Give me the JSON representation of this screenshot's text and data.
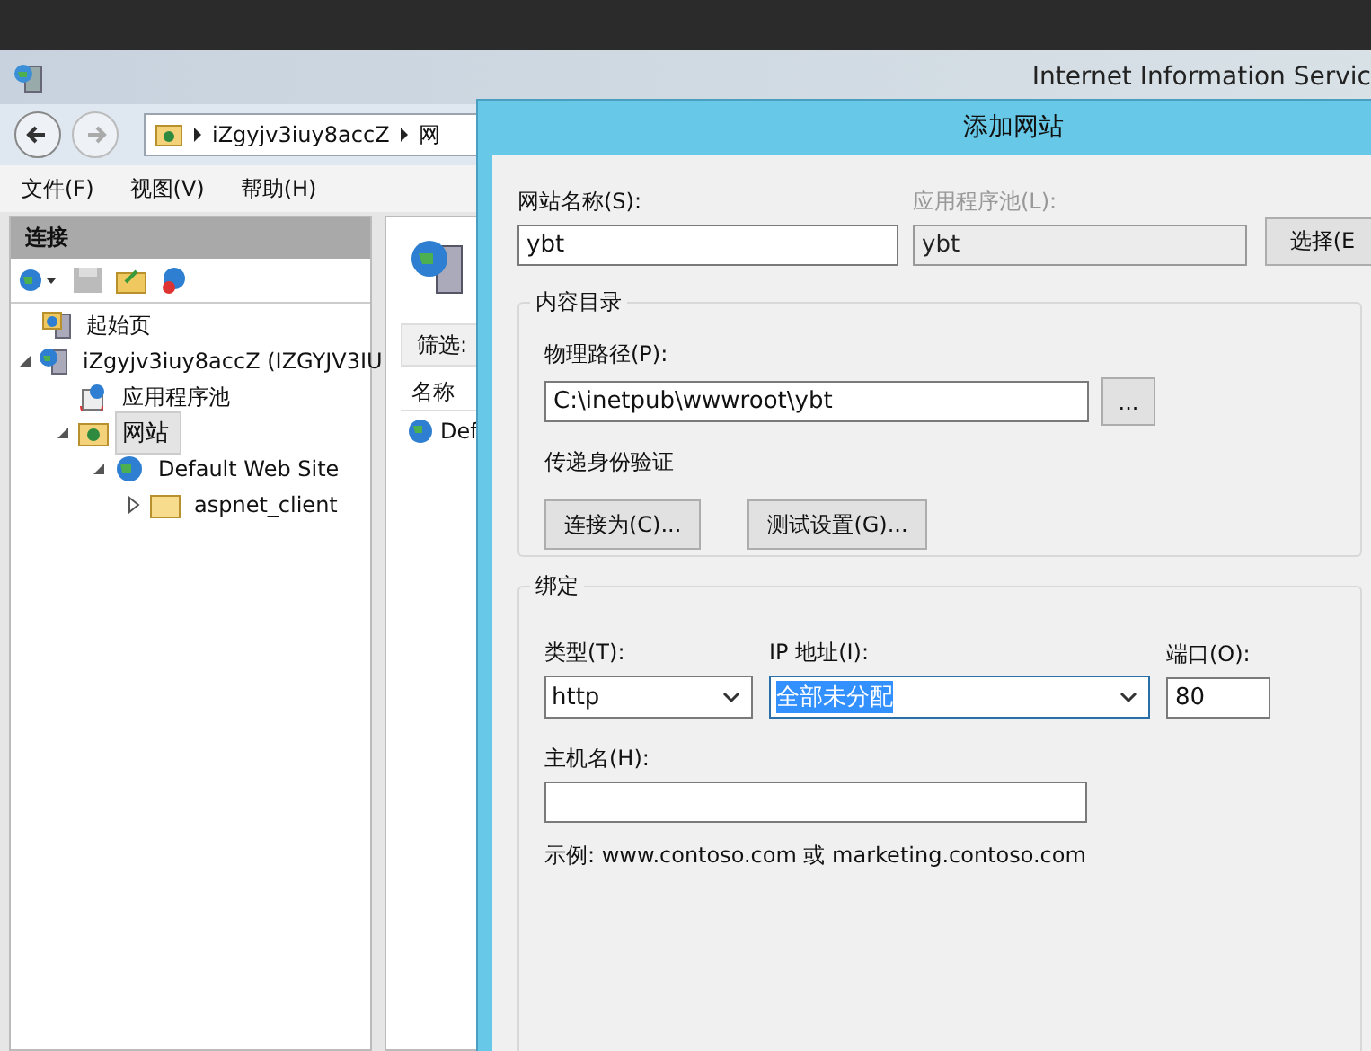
{
  "window": {
    "title": "Internet Information Servic"
  },
  "address_bar": {
    "crumbs": [
      "iZgyjv3iuy8accZ",
      "网"
    ]
  },
  "menu": [
    {
      "label": "文件(F)"
    },
    {
      "label": "视图(V)"
    },
    {
      "label": "帮助(H)"
    }
  ],
  "connections": {
    "title": "连接",
    "tree": [
      {
        "label": "起始页",
        "kind": "start-page",
        "selected": false
      },
      {
        "label": "iZgyjv3iuy8accZ (IZGYJV3IU",
        "kind": "server",
        "expanded": true,
        "selected": false,
        "children": [
          {
            "label": "应用程序池",
            "kind": "app-pools",
            "selected": false
          },
          {
            "label": "网站",
            "kind": "sites",
            "expanded": true,
            "selected": true,
            "children": [
              {
                "label": "Default Web Site",
                "kind": "site",
                "expanded": true,
                "selected": false,
                "children": [
                  {
                    "label": "aspnet_client",
                    "kind": "folder",
                    "expanded": false,
                    "selected": false
                  }
                ]
              }
            ]
          }
        ]
      }
    ]
  },
  "features_pane": {
    "filter_label": "筛选:",
    "column": "名称",
    "rows": [
      "Def"
    ]
  },
  "dialog": {
    "title": "添加网站",
    "site_name": {
      "label": "网站名称(S):",
      "value": "ybt"
    },
    "app_pool": {
      "label": "应用程序池(L):",
      "value": "ybt",
      "disabled": true
    },
    "select_button": "选择(E",
    "content_dir": {
      "title": "内容目录",
      "path_label": "物理路径(P):",
      "path_value": "C:\\inetpub\\wwwroot\\ybt",
      "browse_button": "...",
      "auth_label": "传递身份验证",
      "buttons": [
        "连接为(C)...",
        "测试设置(G)..."
      ]
    },
    "binding": {
      "title": "绑定",
      "type": {
        "label": "类型(T):",
        "value": "http"
      },
      "ip": {
        "label": "IP 地址(I):",
        "value": "全部未分配",
        "highlighted": true
      },
      "port": {
        "label": "端口(O):",
        "value": "80"
      },
      "host": {
        "label": "主机名(H):"
      },
      "example": "示例: www.contoso.com 或 marketing.contoso.com"
    }
  }
}
